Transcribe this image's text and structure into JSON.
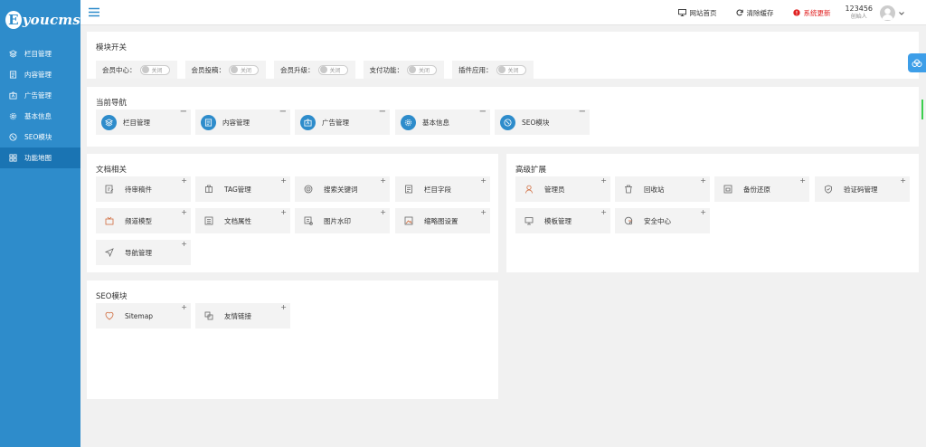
{
  "brand": {
    "mark": "E",
    "name": "youcms"
  },
  "sidebar": {
    "items": [
      {
        "label": "栏目管理",
        "icon": "layers-icon"
      },
      {
        "label": "内容管理",
        "icon": "document-icon"
      },
      {
        "label": "广告管理",
        "icon": "ad-icon"
      },
      {
        "label": "基本信息",
        "icon": "gear-icon"
      },
      {
        "label": "SEO模块",
        "icon": "seo-icon"
      },
      {
        "label": "功能地图",
        "icon": "grid-icon",
        "active": true
      }
    ]
  },
  "topbar": {
    "home_label": "网站首页",
    "clear_cache_label": "清除缓存",
    "update_label": "系统更新",
    "user_name": "123456",
    "user_role": "创始人"
  },
  "modules": {
    "title": "模块开关",
    "switches": [
      {
        "label": "会员中心：",
        "state": "关闭"
      },
      {
        "label": "会员投稿：",
        "state": "关闭"
      },
      {
        "label": "会员升级：",
        "state": "关闭"
      },
      {
        "label": "支付功能：",
        "state": "关闭"
      },
      {
        "label": "插件应用：",
        "state": "关闭"
      }
    ]
  },
  "current_nav": {
    "title": "当前导航",
    "items": [
      {
        "label": "栏目管理",
        "icon": "layers-icon"
      },
      {
        "label": "内容管理",
        "icon": "document-icon"
      },
      {
        "label": "广告管理",
        "icon": "ad-icon"
      },
      {
        "label": "基本信息",
        "icon": "gear-icon"
      },
      {
        "label": "SEO模块",
        "icon": "seo-icon"
      }
    ],
    "corner": "−"
  },
  "doc": {
    "title": "文档相关",
    "items": [
      {
        "label": "待审稿件",
        "icon": "edit-icon"
      },
      {
        "label": "TAG管理",
        "icon": "tag-icon"
      },
      {
        "label": "搜索关键词",
        "icon": "target-icon"
      },
      {
        "label": "栏目字段",
        "icon": "field-icon"
      },
      {
        "label": "频道模型",
        "icon": "tv-icon"
      },
      {
        "label": "文档属性",
        "icon": "list-icon"
      },
      {
        "label": "图片水印",
        "icon": "image-icon"
      },
      {
        "label": "缩略图设置",
        "icon": "thumbnail-icon"
      },
      {
        "label": "导航管理",
        "icon": "send-icon"
      }
    ],
    "corner": "+"
  },
  "advanced": {
    "title": "高级扩展",
    "items": [
      {
        "label": "管理员",
        "icon": "user-icon"
      },
      {
        "label": "回收站",
        "icon": "trash-icon"
      },
      {
        "label": "备份还原",
        "icon": "backup-icon"
      },
      {
        "label": "验证码管理",
        "icon": "shield-icon"
      },
      {
        "label": "模板管理",
        "icon": "monitor-icon"
      },
      {
        "label": "安全中心",
        "icon": "security-icon"
      }
    ],
    "corner": "+"
  },
  "seo": {
    "title": "SEO模块",
    "items": [
      {
        "label": "Sitemap",
        "icon": "sitemap-icon"
      },
      {
        "label": "友情链接",
        "icon": "link-icon"
      }
    ],
    "corner": "+"
  },
  "colors": {
    "sidebar": "#2e8ccb",
    "active": "#1a74b3",
    "tile": "#f3f3f3",
    "alert": "#e02020",
    "accent": "#3d9ee8"
  }
}
